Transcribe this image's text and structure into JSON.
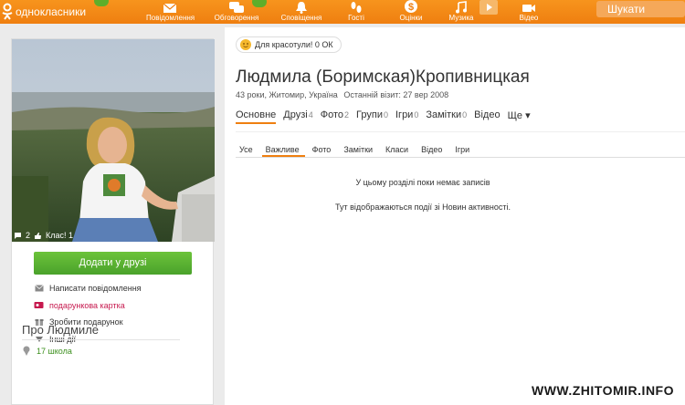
{
  "topbar": {
    "logo_text": "однокласники",
    "nav": [
      {
        "label": "Повідомлення",
        "icon": "envelope-icon"
      },
      {
        "label": "Обговорення",
        "icon": "speech-bubbles-icon"
      },
      {
        "label": "Сповіщення",
        "icon": "bell-icon"
      },
      {
        "label": "Гості",
        "icon": "footprints-icon"
      },
      {
        "label": "Оцінки",
        "icon": "dollar-icon"
      },
      {
        "label": "Музика",
        "icon": "music-note-icon"
      },
      {
        "label": "Відео",
        "icon": "video-camera-icon"
      }
    ],
    "search_placeholder": "Шукати"
  },
  "profile": {
    "status_text": "Для красотули! 0 ОК",
    "name": "Людмила (Боримская)Кропивницкая",
    "meta": "43 роки, Житомир, Україна",
    "last_visit": "Останній візит: 27 вер 2008",
    "avatar_comments": "2",
    "avatar_likes": "Клас! 1"
  },
  "tabs": [
    {
      "label": "Основне",
      "count": ""
    },
    {
      "label": "Друзі",
      "count": "4"
    },
    {
      "label": "Фото",
      "count": "2"
    },
    {
      "label": "Групи",
      "count": "0"
    },
    {
      "label": "Ігри",
      "count": "0"
    },
    {
      "label": "Замітки",
      "count": "0"
    },
    {
      "label": "Відео",
      "count": ""
    },
    {
      "label": "Ще ▾",
      "count": ""
    }
  ],
  "subtabs": [
    "Усе",
    "Важливе",
    "Фото",
    "Замітки",
    "Класи",
    "Відео",
    "Ігри"
  ],
  "feed": {
    "empty_title": "У цьому розділі поки немає записів",
    "empty_note": "Тут відображаються події зі Новин активності."
  },
  "left": {
    "add_friend": "Додати у друзі",
    "actions": [
      {
        "label": "Написати повідомлення",
        "icon": "envelope-icon"
      },
      {
        "label": "подарункова картка",
        "icon": "gift-card-icon"
      },
      {
        "label": "Зробити подарунок",
        "icon": "gift-icon"
      },
      {
        "label": "Інші дії",
        "icon": "arrow-down-icon"
      }
    ],
    "about_title": "Про Людмиле",
    "about_school": "17 школа"
  },
  "watermark": "WWW.ZHITOMIR.INFO",
  "colors": {
    "accent": "#ef7f10",
    "green": "#4aa22b",
    "pink": "#c6194e"
  }
}
